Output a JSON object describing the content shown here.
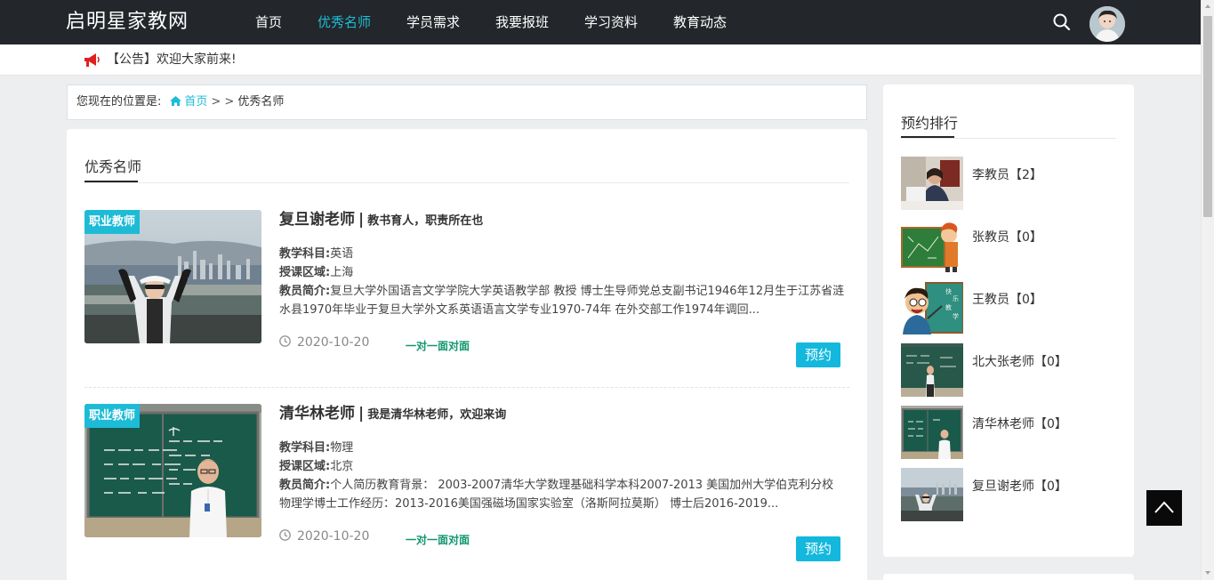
{
  "header": {
    "logo": "启明星家教网",
    "nav": [
      {
        "label": "首页",
        "active": false
      },
      {
        "label": "优秀名师",
        "active": true
      },
      {
        "label": "学员需求",
        "active": false
      },
      {
        "label": "我要报班",
        "active": false
      },
      {
        "label": "学习资料",
        "active": false
      },
      {
        "label": "教育动态",
        "active": false
      }
    ],
    "icons": [
      "search-icon",
      "avatar"
    ]
  },
  "notice": {
    "icon": "megaphone-icon",
    "text": "【公告】欢迎大家前来!"
  },
  "breadcrumb": {
    "prefix": "您现在的位置是:",
    "home": "首页",
    "separator": "> >",
    "current": "优秀名师"
  },
  "main": {
    "title": "优秀名师",
    "teachers": [
      {
        "tag": "职业教师",
        "name": "复旦谢老师",
        "separator": "|",
        "motto": "教书育人，职责所在也",
        "subject_label": "教学科目:",
        "subject": "英语",
        "area_label": "授课区域:",
        "area": "上海",
        "intro_label": "教员简介:",
        "intro": "复旦大学外国语言文学学院大学英语教学部 教授 博士生导师党总支副书记1946年12月生于江苏省涟水县1970年毕业于复旦大学外文系英语语言文学专业1970-74年 在外交部工作1974年调回...",
        "date": "2020-10-20",
        "mode": "一对一面对面",
        "button": "预约"
      },
      {
        "tag": "职业教师",
        "name": "清华林老师",
        "separator": "|",
        "motto": "我是清华林老师，欢迎来询",
        "subject_label": "教学科目:",
        "subject": "物理",
        "area_label": "授课区域:",
        "area": "北京",
        "intro_label": "教员简介:",
        "intro": "个人简历教育背景： 2003-2007清华大学数理基础科学本科2007-2013 美国加州大学伯克利分校物理学博士工作经历：2013-2016美国强磁场国家实验室（洛斯阿拉莫斯） 博士后2016-2019...",
        "date": "2020-10-20",
        "mode": "一对一面对面",
        "button": "预约"
      }
    ]
  },
  "sidebar": {
    "title": "预约排行",
    "ranking": [
      {
        "name": "李教员【2】"
      },
      {
        "name": "张教员【0】"
      },
      {
        "name": "王教员【0】"
      },
      {
        "name": "北大张老师【0】"
      },
      {
        "name": "清华林老师【0】"
      },
      {
        "name": "复旦谢老师【0】"
      }
    ]
  },
  "colors": {
    "accent": "#1ebbd6",
    "header_bg": "#23272b",
    "button": "#13b8dc",
    "mode_text": "#12966e"
  }
}
